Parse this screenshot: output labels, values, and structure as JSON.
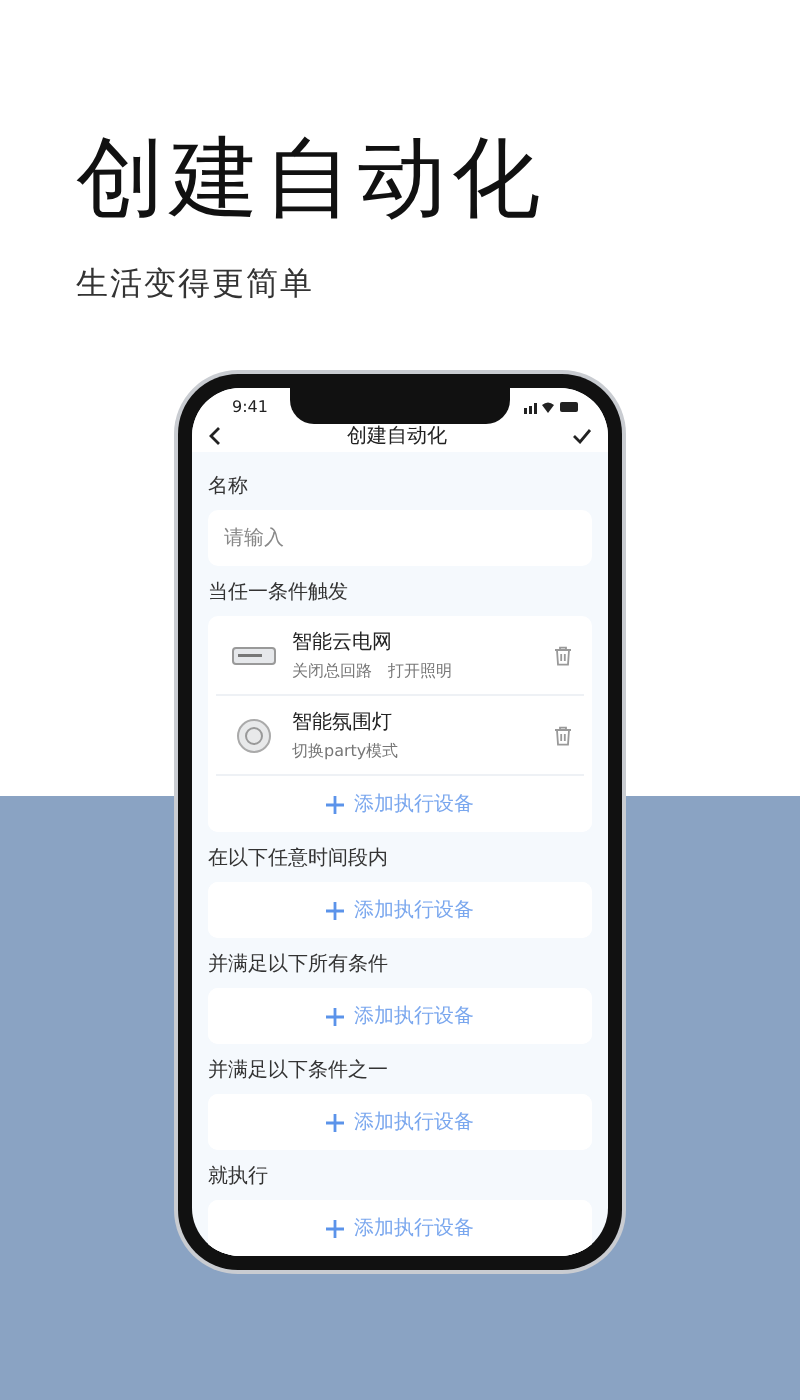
{
  "headline": "创建自动化",
  "subtitle": "生活变得更简单",
  "phone": {
    "status_bar": {
      "time": "9:41"
    },
    "nav": {
      "title": "创建自动化"
    },
    "name_field": {
      "label": "名称",
      "placeholder": "请输入"
    },
    "sections": [
      {
        "label": "当任一条件触发",
        "devices": [
          {
            "kind": "strip",
            "name": "智能云电网",
            "details": [
              "关闭总回路",
              "打开照明"
            ]
          },
          {
            "kind": "lamp",
            "name": "智能氛围灯",
            "details": [
              "切换party模式"
            ]
          }
        ],
        "add_button": "添加执行设备"
      },
      {
        "label": "在以下任意时间段内",
        "add_button": "添加执行设备"
      },
      {
        "label": "并满足以下所有条件",
        "add_button": "添加执行设备"
      },
      {
        "label": "并满足以下条件之一",
        "add_button": "添加执行设备"
      },
      {
        "label": "就执行",
        "add_button": "添加执行设备"
      }
    ]
  }
}
